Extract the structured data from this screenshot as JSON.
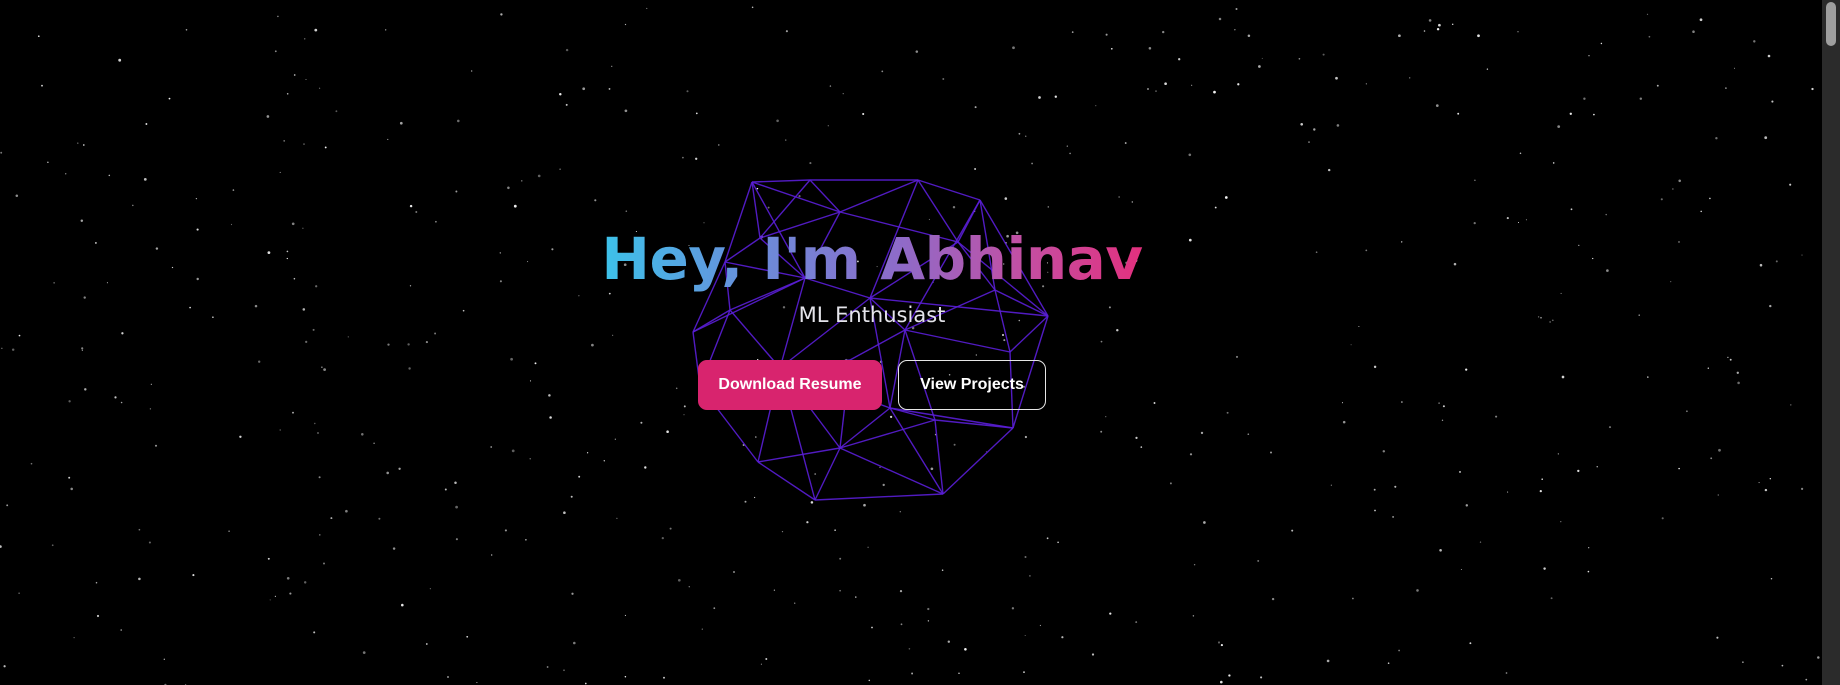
{
  "hero": {
    "title": "Hey, I'm Abhinav",
    "subtitle": "ML Enthusiast",
    "primary_button_label": "Download Resume",
    "secondary_button_label": "View Projects"
  },
  "colors": {
    "background": "#000000",
    "gradient_start": "#3cc3ea",
    "gradient_mid": "#8e6bc9",
    "gradient_end": "#e3307e",
    "primary_button": "#d8246e",
    "wireframe": "#5a1ed6"
  },
  "decorations": {
    "background_icon": "starfield",
    "hero_graphic_icon": "wireframe-polyhedron"
  }
}
